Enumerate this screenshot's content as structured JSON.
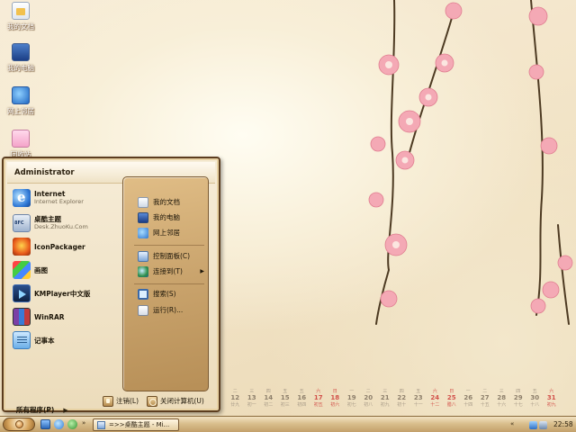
{
  "desktop": {
    "icons": [
      {
        "label": "我的文档",
        "icon": "my-documents-icon"
      },
      {
        "label": "我的电脑",
        "icon": "my-computer-icon"
      },
      {
        "label": "网上邻居",
        "icon": "network-places-icon"
      },
      {
        "label": "回收站",
        "icon": "recycle-bin-icon"
      }
    ]
  },
  "calendar": {
    "days": [
      {
        "top": "二",
        "num": "12",
        "sub": "廿九",
        "weekend": false
      },
      {
        "top": "三",
        "num": "13",
        "sub": "初一",
        "weekend": false
      },
      {
        "top": "四",
        "num": "14",
        "sub": "初二",
        "weekend": false
      },
      {
        "top": "五",
        "num": "15",
        "sub": "初三",
        "weekend": false
      },
      {
        "top": "五",
        "num": "16",
        "sub": "初四",
        "weekend": false
      },
      {
        "top": "六",
        "num": "17",
        "sub": "初五",
        "weekend": true
      },
      {
        "top": "日",
        "num": "18",
        "sub": "初六",
        "weekend": true
      },
      {
        "top": "一",
        "num": "19",
        "sub": "初七",
        "weekend": false
      },
      {
        "top": "二",
        "num": "20",
        "sub": "初八",
        "weekend": false
      },
      {
        "top": "三",
        "num": "21",
        "sub": "初九",
        "weekend": false
      },
      {
        "top": "四",
        "num": "22",
        "sub": "初十",
        "weekend": false
      },
      {
        "top": "五",
        "num": "23",
        "sub": "十一",
        "weekend": false
      },
      {
        "top": "六",
        "num": "24",
        "sub": "十二",
        "weekend": true
      },
      {
        "top": "日",
        "num": "25",
        "sub": "腊八",
        "weekend": true
      },
      {
        "top": "一",
        "num": "26",
        "sub": "十四",
        "weekend": false
      },
      {
        "top": "二",
        "num": "27",
        "sub": "十五",
        "weekend": false
      },
      {
        "top": "三",
        "num": "28",
        "sub": "十六",
        "weekend": false
      },
      {
        "top": "四",
        "num": "29",
        "sub": "十七",
        "weekend": false
      },
      {
        "top": "五",
        "num": "30",
        "sub": "十八",
        "weekend": false
      },
      {
        "top": "六",
        "num": "31",
        "sub": "初九",
        "weekend": true
      }
    ]
  },
  "start_menu": {
    "user": "Administrator",
    "programs": [
      {
        "name": "Internet",
        "sub": "Internet Explorer",
        "icon": "internet-explorer-icon"
      },
      {
        "name": "桌酷主题",
        "sub": "Desk.ZhuoKu.Com",
        "icon": "zhuoku-icon"
      },
      {
        "name": "IconPackager",
        "sub": "",
        "icon": "iconpackager-icon"
      },
      {
        "name": "画图",
        "sub": "",
        "icon": "paint-icon"
      },
      {
        "name": "KMPlayer中文版",
        "sub": "",
        "icon": "kmplayer-icon"
      },
      {
        "name": "WinRAR",
        "sub": "",
        "icon": "winrar-icon"
      },
      {
        "name": "记事本",
        "sub": "",
        "icon": "notepad-icon"
      }
    ],
    "all_programs": "所有程序(P)",
    "places": [
      {
        "label": "我的文档",
        "icon": "my-documents-icon"
      },
      {
        "label": "我的电脑",
        "icon": "my-computer-icon"
      },
      {
        "label": "网上邻居",
        "icon": "network-places-icon"
      },
      {
        "label": "控制面板(C)",
        "icon": "control-panel-icon"
      },
      {
        "label": "连接到(T)",
        "icon": "connect-to-icon"
      },
      {
        "label": "搜索(S)",
        "icon": "search-icon"
      },
      {
        "label": "运行(R)...",
        "icon": "run-icon"
      }
    ],
    "logoff": "注销(L)",
    "shutdown": "关闭计算机(U)"
  },
  "taskbar": {
    "window_title": "=>>桌酷主题 - Mi...",
    "clock": "22:58"
  },
  "colors": {
    "menu_border": "#5c3d1f",
    "right_panel": "#c9a36c",
    "taskbar": "#d9bf8d",
    "weekend": "#d2504a"
  }
}
